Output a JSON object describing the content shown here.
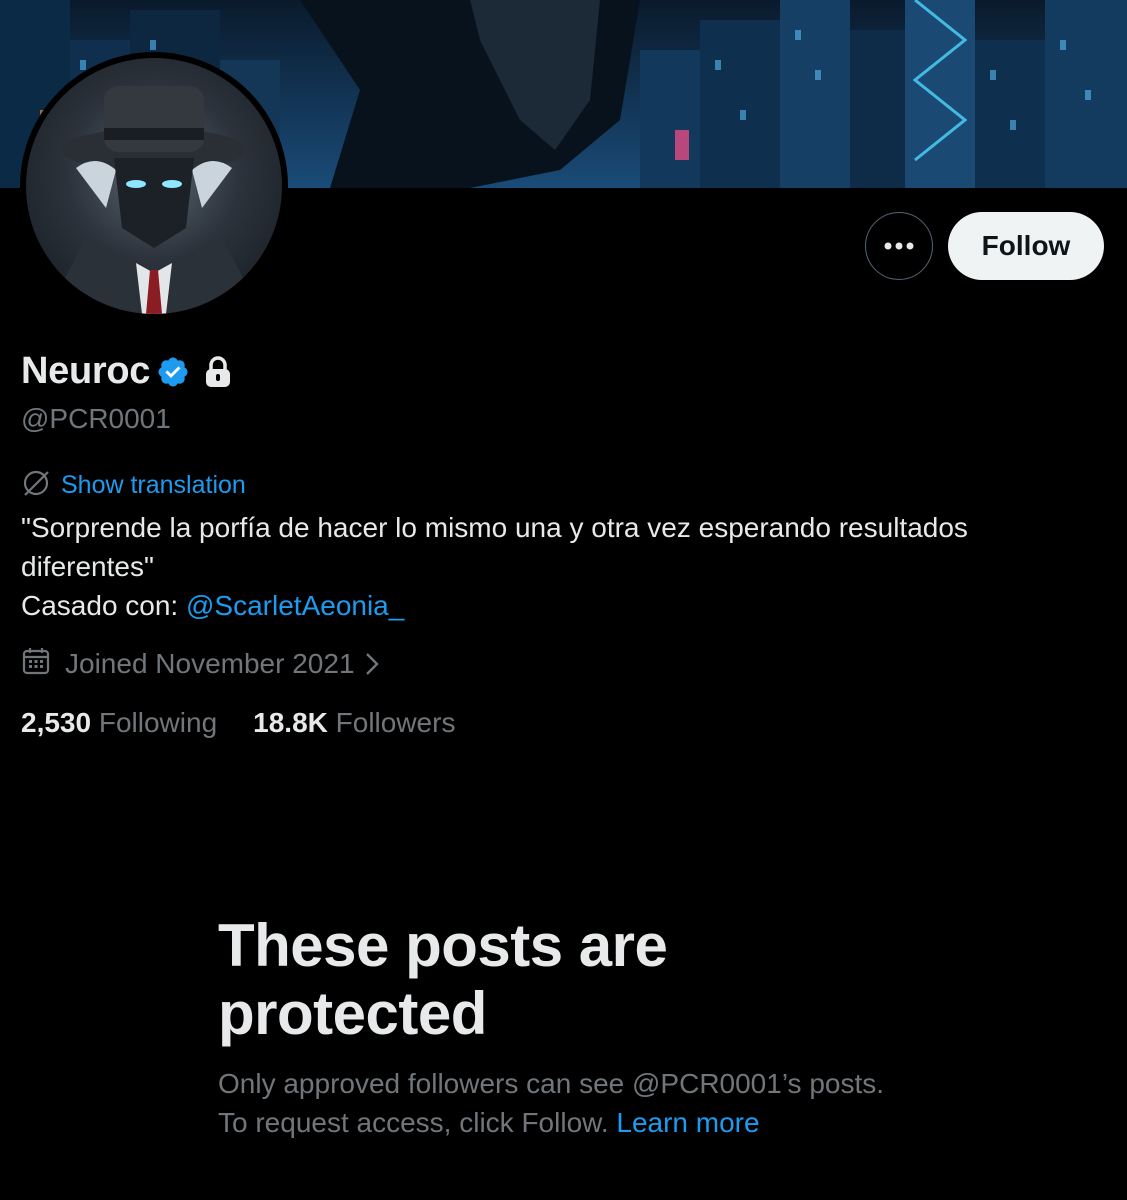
{
  "profile": {
    "display_name": "Neuroc",
    "handle": "@PCR0001",
    "verified": true,
    "protected": true
  },
  "actions": {
    "more_icon": "ellipsis-icon",
    "follow_label": "Follow"
  },
  "translation": {
    "label": "Show translation",
    "icon": "translate-icon"
  },
  "bio": {
    "quote": "\"Sorprende la porfía de hacer lo mismo una y otra vez esperando resultados diferentes\"",
    "married_prefix": "Casado con: ",
    "married_mention": "@ScarletAeonia_"
  },
  "joined": {
    "text": "Joined November 2021",
    "icon": "calendar-icon"
  },
  "stats": {
    "following_count": "2,530",
    "following_label": "Following",
    "followers_count": "18.8K",
    "followers_label": "Followers"
  },
  "protected_notice": {
    "title": "These posts are protected",
    "body": "Only approved followers can see @PCR0001’s posts. To request access, click Follow.",
    "link": "Learn more"
  },
  "colors": {
    "background": "#000000",
    "accent": "#1d9bf0",
    "text_primary": "#e7e9ea",
    "text_secondary": "#71767b",
    "follow_bg": "#eff3f4"
  }
}
